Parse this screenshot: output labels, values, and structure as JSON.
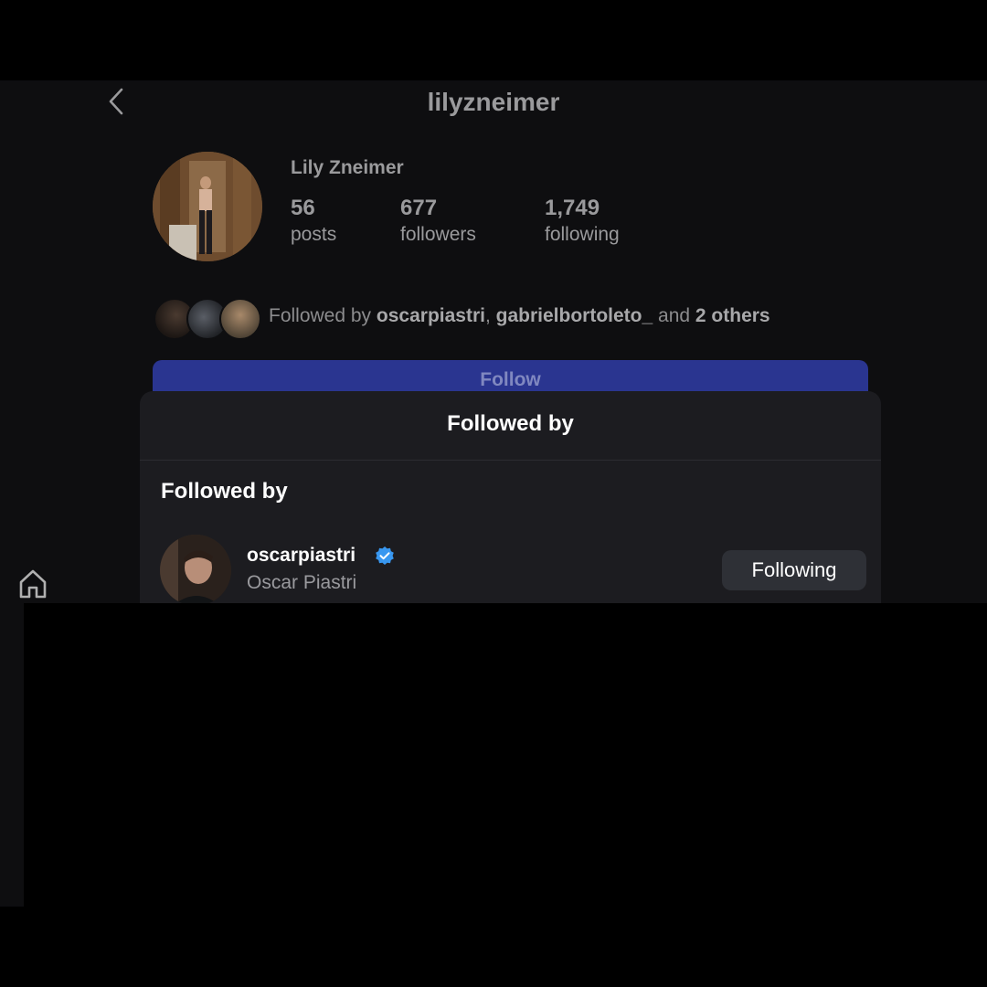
{
  "header": {
    "username": "lilyzneimer"
  },
  "profile": {
    "display_name": "Lily Zneimer",
    "stats": {
      "posts_count": "56",
      "posts_label": "posts",
      "followers_count": "677",
      "followers_label": "followers",
      "following_count": "1,749",
      "following_label": "following"
    },
    "mutuals": {
      "prefix": "Followed by",
      "user1": "oscarpiastri",
      "separator": ",",
      "user2": "gabrielbortoleto_",
      "middle": "and",
      "others": "2 others"
    },
    "follow_button": "Follow"
  },
  "sheet": {
    "title": "Followed by",
    "section_heading": "Followed by",
    "users": [
      {
        "username": "oscarpiastri",
        "full_name": "Oscar Piastri",
        "verified": true,
        "button_label": "Following"
      }
    ]
  },
  "colors": {
    "follow_button_bg": "#2a3590",
    "verified_badge": "#3897f0",
    "sheet_bg": "#1c1c20"
  }
}
